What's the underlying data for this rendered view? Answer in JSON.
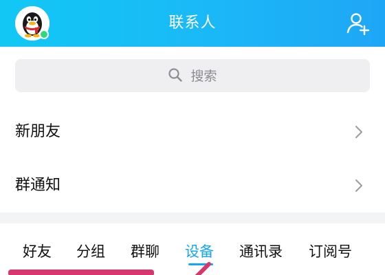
{
  "header": {
    "title": "联系人",
    "accent": "#1bb8f7",
    "avatar_icon": "qq-penguin-avatar-icon",
    "add_icon": "add-contact-icon"
  },
  "search": {
    "placeholder": "搜索",
    "icon": "search-icon"
  },
  "rows": [
    {
      "label": "新朋友",
      "icon": "chevron-right-icon"
    },
    {
      "label": "群通知",
      "icon": "chevron-right-icon"
    }
  ],
  "tabs": [
    {
      "label": "好友",
      "active": false
    },
    {
      "label": "分组",
      "active": false
    },
    {
      "label": "群聊",
      "active": false
    },
    {
      "label": "设备",
      "active": true
    },
    {
      "label": "通讯录",
      "active": false
    },
    {
      "label": "订阅号",
      "active": false
    }
  ],
  "colors": {
    "active_tab": "#12a6f4",
    "annotation": "#d6386e",
    "online_status": "#2fd97b"
  }
}
